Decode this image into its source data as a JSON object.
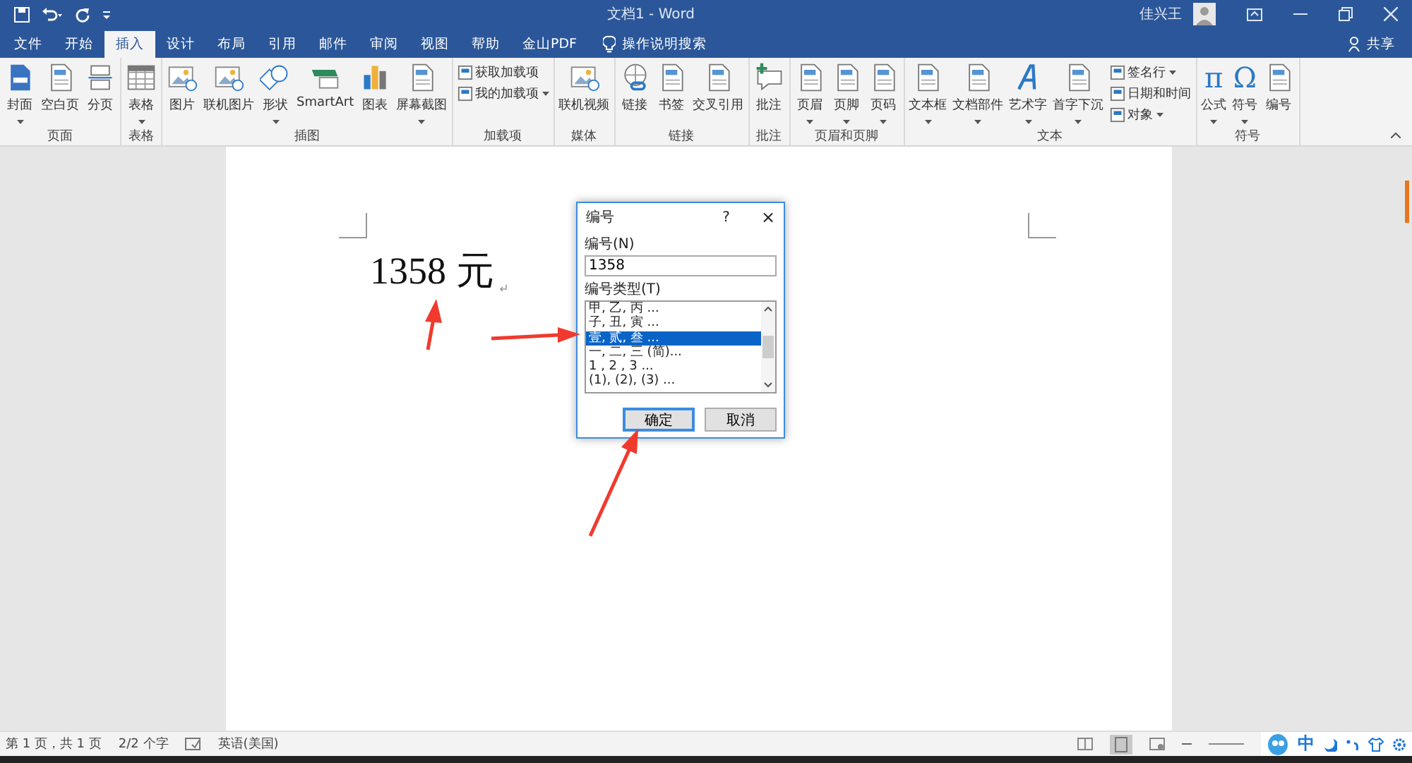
{
  "window": {
    "title": "文档1 - Word",
    "user": "佳兴王",
    "share": "共享"
  },
  "tabs": [
    {
      "label": "文件",
      "selected": false
    },
    {
      "label": "开始",
      "selected": false
    },
    {
      "label": "插入",
      "selected": true
    },
    {
      "label": "设计",
      "selected": false
    },
    {
      "label": "布局",
      "selected": false
    },
    {
      "label": "引用",
      "selected": false
    },
    {
      "label": "邮件",
      "selected": false
    },
    {
      "label": "审阅",
      "selected": false
    },
    {
      "label": "视图",
      "selected": false
    },
    {
      "label": "帮助",
      "selected": false
    },
    {
      "label": "金山PDF",
      "selected": false
    }
  ],
  "tell_me": {
    "placeholder": "操作说明搜索"
  },
  "ribbon": [
    {
      "label": "页面",
      "items": [
        {
          "kind": "big",
          "label": "封面",
          "dropdown": true
        },
        {
          "kind": "big",
          "label": "空白页",
          "dropdown": false
        },
        {
          "kind": "big",
          "label": "分页",
          "dropdown": false
        }
      ]
    },
    {
      "label": "表格",
      "items": [
        {
          "kind": "big",
          "label": "表格",
          "dropdown": true
        }
      ]
    },
    {
      "label": "插图",
      "items": [
        {
          "kind": "big",
          "label": "图片",
          "dropdown": false
        },
        {
          "kind": "big",
          "label": "联机图片",
          "dropdown": false
        },
        {
          "kind": "big",
          "label": "形状",
          "dropdown": true
        },
        {
          "kind": "big",
          "label": "SmartArt",
          "dropdown": false
        },
        {
          "kind": "big",
          "label": "图表",
          "dropdown": false
        },
        {
          "kind": "big",
          "label": "屏幕截图",
          "dropdown": true
        }
      ]
    },
    {
      "label": "加载项",
      "items": [
        {
          "kind": "small",
          "label": "获取加载项",
          "dropdown": false
        },
        {
          "kind": "small",
          "label": "我的加载项",
          "dropdown": true
        }
      ]
    },
    {
      "label": "媒体",
      "items": [
        {
          "kind": "big",
          "label": "联机视频",
          "dropdown": false
        }
      ]
    },
    {
      "label": "链接",
      "items": [
        {
          "kind": "big",
          "label": "链接",
          "dropdown": false
        },
        {
          "kind": "big",
          "label": "书签",
          "dropdown": false
        },
        {
          "kind": "big",
          "label": "交叉引用",
          "dropdown": false
        }
      ]
    },
    {
      "label": "批注",
      "items": [
        {
          "kind": "big",
          "label": "批注",
          "dropdown": false
        }
      ]
    },
    {
      "label": "页眉和页脚",
      "items": [
        {
          "kind": "big",
          "label": "页眉",
          "dropdown": true
        },
        {
          "kind": "big",
          "label": "页脚",
          "dropdown": true
        },
        {
          "kind": "big",
          "label": "页码",
          "dropdown": true
        }
      ]
    },
    {
      "label": "文本",
      "items": [
        {
          "kind": "big",
          "label": "文本框",
          "dropdown": true
        },
        {
          "kind": "big",
          "label": "文档部件",
          "dropdown": true
        },
        {
          "kind": "big",
          "label": "艺术字",
          "dropdown": true
        },
        {
          "kind": "big",
          "label": "首字下沉",
          "dropdown": true
        },
        {
          "kind": "small",
          "label": "签名行",
          "dropdown": true
        },
        {
          "kind": "small",
          "label": "日期和时间",
          "dropdown": false
        },
        {
          "kind": "small",
          "label": "对象",
          "dropdown": true
        }
      ]
    },
    {
      "label": "符号",
      "items": [
        {
          "kind": "big",
          "label": "公式",
          "dropdown": true,
          "glyph": "π"
        },
        {
          "kind": "big",
          "label": "符号",
          "dropdown": true,
          "glyph": "Ω"
        },
        {
          "kind": "big",
          "label": "编号",
          "dropdown": false
        }
      ]
    }
  ],
  "document": {
    "text": "1358 元"
  },
  "dialog": {
    "title": "编号",
    "help": "?",
    "close": "×",
    "number_label": "编号(N)",
    "number_value": "1358",
    "type_label": "编号类型(T)",
    "types": [
      {
        "label": "甲, 乙, 丙 ...",
        "selected": false
      },
      {
        "label": "子, 丑, 寅 ...",
        "selected": false
      },
      {
        "label": "壹, 贰, 叁 ...",
        "selected": true
      },
      {
        "label": "一, 二, 三 (简)...",
        "selected": false
      },
      {
        "label": "1 , 2 , 3 ...",
        "selected": false
      },
      {
        "label": "(1), (2), (3) ...",
        "selected": false
      }
    ],
    "ok": "确定",
    "cancel": "取消"
  },
  "status_bar": {
    "page": "第 1 页，共 1 页",
    "words": "2/2 个字",
    "language": "英语(美国)"
  },
  "ime": {
    "mode": "中"
  }
}
